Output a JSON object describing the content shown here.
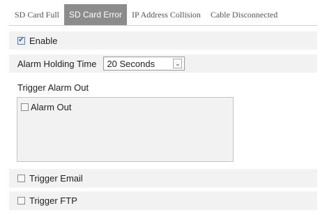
{
  "tabs": [
    {
      "label": "SD Card Full",
      "active": false
    },
    {
      "label": "SD Card Error",
      "active": true
    },
    {
      "label": "IP Address Collision",
      "active": false
    },
    {
      "label": "Cable Disconnected",
      "active": false
    }
  ],
  "enable": {
    "label": "Enable",
    "checked": true
  },
  "alarm_holding_time": {
    "label": "Alarm Holding Time",
    "value": "20 Seconds",
    "arrow_icon": "chevron-down-icon"
  },
  "trigger_alarm_out": {
    "label": "Trigger Alarm Out",
    "items": [
      {
        "label": "Alarm Out",
        "checked": false
      }
    ]
  },
  "trigger_email": {
    "label": "Trigger Email",
    "checked": false
  },
  "trigger_ftp": {
    "label": "Trigger FTP",
    "checked": false
  },
  "colors": {
    "active_tab": "#8c8c8c",
    "row_background": "#f2f2f2",
    "check_mark": "#2e5fb5"
  }
}
